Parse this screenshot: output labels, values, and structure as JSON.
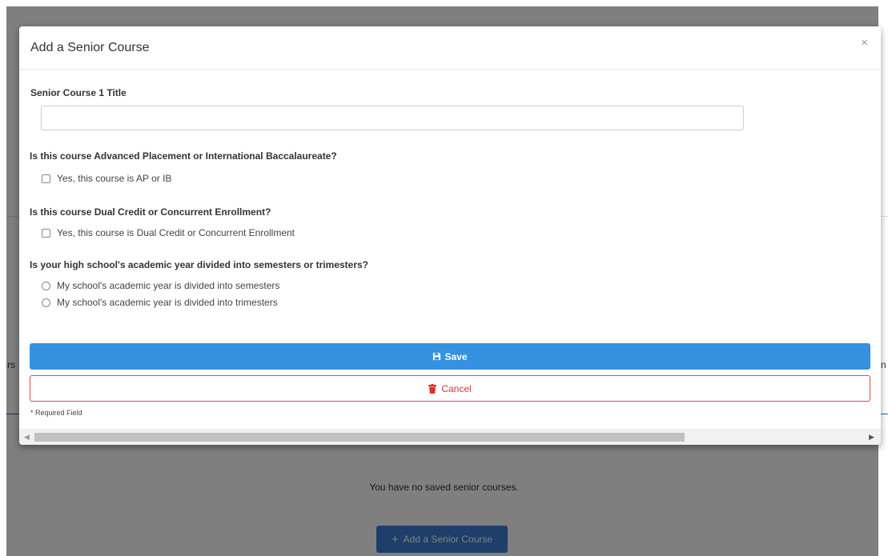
{
  "background": {
    "empty_message": "You have no saved senior courses.",
    "add_button_label": "Add a Senior Course",
    "left_fragment": "rs",
    "right_fragment": "n"
  },
  "modal": {
    "title": "Add a Senior Course",
    "close_symbol": "×",
    "course_title_label": "Senior Course 1 Title",
    "course_title_value": "",
    "ap_ib_question": "Is this course Advanced Placement or International Baccalaureate?",
    "ap_ib_option": "Yes, this course is AP or IB",
    "dual_credit_question": "Is this course Dual Credit or Concurrent Enrollment?",
    "dual_credit_option": "Yes, this course is Dual Credit or Concurrent Enrollment",
    "term_question": "Is your high school's academic year divided into semesters or trimesters?",
    "term_options": [
      "My school's academic year is divided into semesters",
      "My school's academic year is divided into trimesters"
    ],
    "save_label": "Save",
    "cancel_label": "Cancel",
    "required_note": "* Required Field"
  },
  "colors": {
    "primary": "#3691e0",
    "danger": "#e03030",
    "overlay": "rgba(0,0,0,0.5)"
  },
  "icons": {
    "save": "floppy-disk-icon",
    "cancel": "trash-icon",
    "add": "plus-icon",
    "close": "close-icon"
  }
}
